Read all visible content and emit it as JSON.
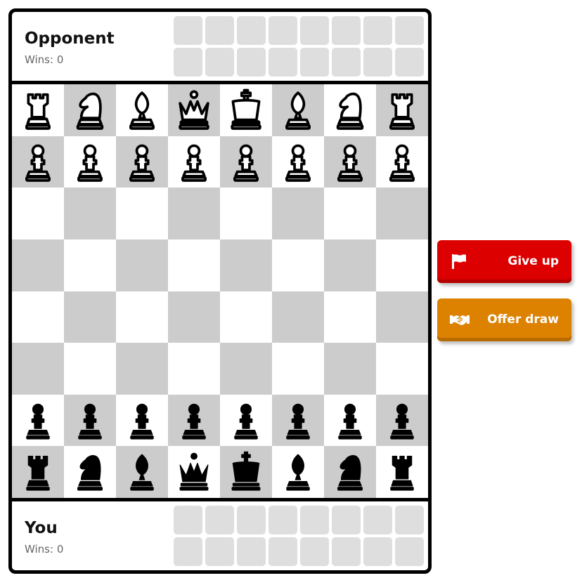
{
  "opponent": {
    "name": "Opponent",
    "wins": "Wins: 0"
  },
  "you": {
    "name": "You",
    "wins": "Wins: 0"
  },
  "actions": {
    "give_up": {
      "label": "Give up",
      "icon": "flag-icon",
      "color": "#dd0000"
    },
    "offer_draw": {
      "label": "Offer draw",
      "icon": "handshake-icon",
      "color": "#dd8200"
    }
  },
  "board": {
    "light_color": "#ffffff",
    "dark_color": "#cccccc",
    "ranks": [
      [
        {
          "piece": "rook",
          "color": "white"
        },
        {
          "piece": "knight",
          "color": "white"
        },
        {
          "piece": "bishop",
          "color": "white"
        },
        {
          "piece": "queen",
          "color": "white"
        },
        {
          "piece": "king",
          "color": "white"
        },
        {
          "piece": "bishop",
          "color": "white"
        },
        {
          "piece": "knight",
          "color": "white"
        },
        {
          "piece": "rook",
          "color": "white"
        }
      ],
      [
        {
          "piece": "pawn",
          "color": "white"
        },
        {
          "piece": "pawn",
          "color": "white"
        },
        {
          "piece": "pawn",
          "color": "white"
        },
        {
          "piece": "pawn",
          "color": "white"
        },
        {
          "piece": "pawn",
          "color": "white"
        },
        {
          "piece": "pawn",
          "color": "white"
        },
        {
          "piece": "pawn",
          "color": "white"
        },
        {
          "piece": "pawn",
          "color": "white"
        }
      ],
      [
        null,
        null,
        null,
        null,
        null,
        null,
        null,
        null
      ],
      [
        null,
        null,
        null,
        null,
        null,
        null,
        null,
        null
      ],
      [
        null,
        null,
        null,
        null,
        null,
        null,
        null,
        null
      ],
      [
        null,
        null,
        null,
        null,
        null,
        null,
        null,
        null
      ],
      [
        {
          "piece": "pawn",
          "color": "black"
        },
        {
          "piece": "pawn",
          "color": "black"
        },
        {
          "piece": "pawn",
          "color": "black"
        },
        {
          "piece": "pawn",
          "color": "black"
        },
        {
          "piece": "pawn",
          "color": "black"
        },
        {
          "piece": "pawn",
          "color": "black"
        },
        {
          "piece": "pawn",
          "color": "black"
        },
        {
          "piece": "pawn",
          "color": "black"
        }
      ],
      [
        {
          "piece": "rook",
          "color": "black"
        },
        {
          "piece": "knight",
          "color": "black"
        },
        {
          "piece": "bishop",
          "color": "black"
        },
        {
          "piece": "queen",
          "color": "black"
        },
        {
          "piece": "king",
          "color": "black"
        },
        {
          "piece": "bishop",
          "color": "black"
        },
        {
          "piece": "knight",
          "color": "black"
        },
        {
          "piece": "rook",
          "color": "black"
        }
      ]
    ]
  },
  "captured": {
    "opponent_slots": 16,
    "you_slots": 16
  }
}
